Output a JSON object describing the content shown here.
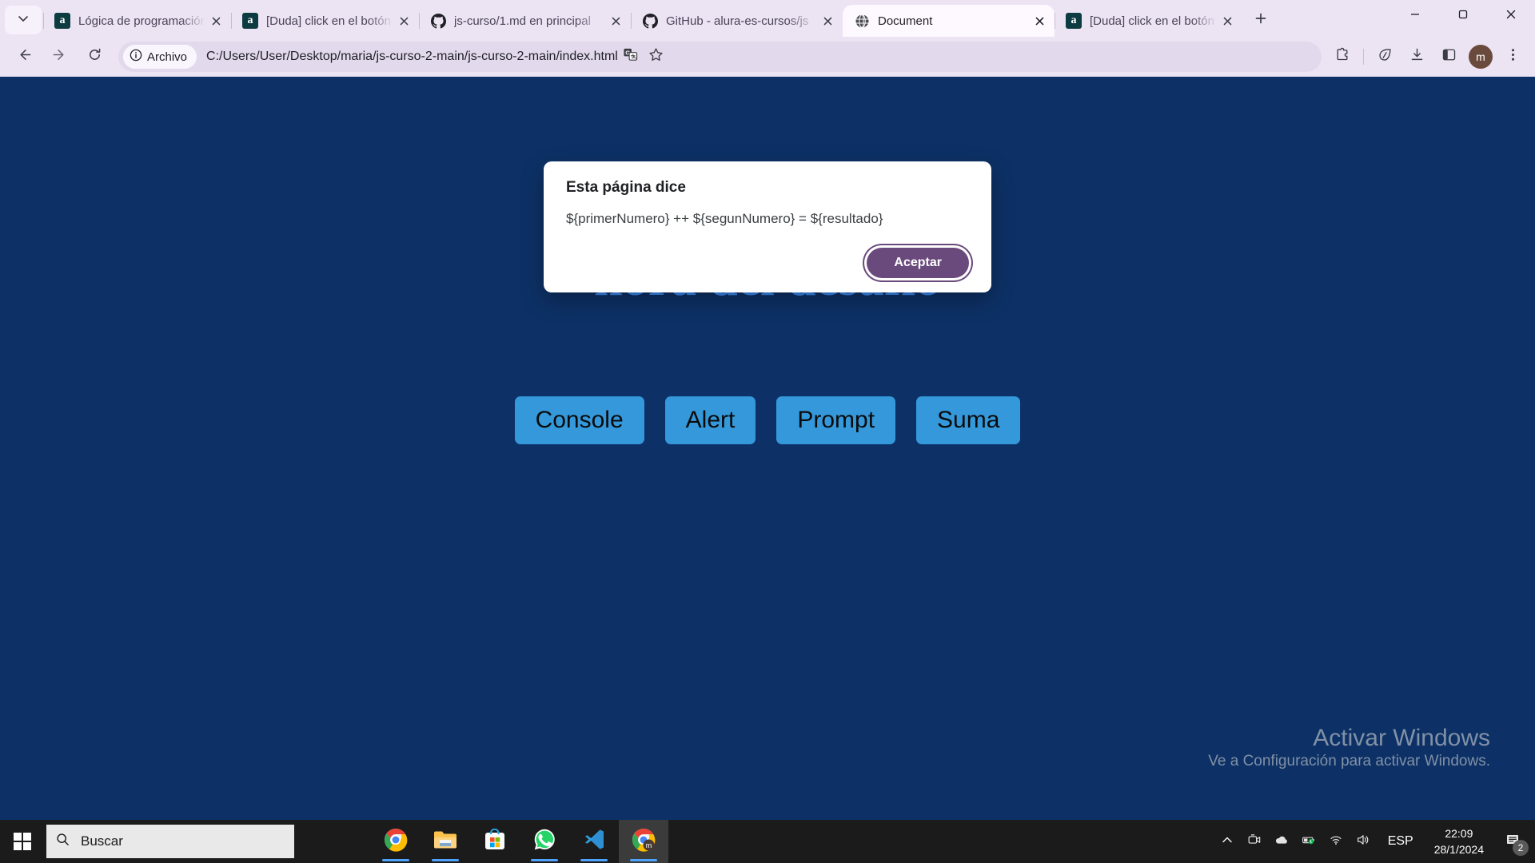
{
  "browser": {
    "tab_list_icon": "chevron-down-icon",
    "tabs": [
      {
        "title": "Lógica de programación: e",
        "favicon": "alura-icon",
        "active": false
      },
      {
        "title": "[Duda] click en el botón | L",
        "favicon": "alura-icon",
        "active": false
      },
      {
        "title": "js-curso/1.md en principal",
        "favicon": "github-icon",
        "active": false
      },
      {
        "title": "GitHub - alura-es-cursos/js",
        "favicon": "github-icon",
        "active": false
      },
      {
        "title": "Document",
        "favicon": "globe-icon",
        "active": true
      },
      {
        "title": "[Duda] click en el botón | L",
        "favicon": "alura-icon",
        "active": false
      }
    ],
    "new_tab_label": "+",
    "window_controls": {
      "minimize": "minimize-icon",
      "maximize": "maximize-icon",
      "close": "close-icon"
    },
    "toolbar": {
      "back": "back-arrow-icon",
      "forward": "forward-arrow-icon",
      "reload": "reload-icon",
      "security_chip_label": "Archivo",
      "security_chip_icon": "info-circle-icon",
      "url": "C:/Users/User/Desktop/maria/js-curso-2-main/js-curso-2-main/index.html",
      "translate_icon": "translate-icon",
      "bookmark_icon": "star-icon",
      "extensions_icon": "puzzle-piece-icon",
      "performance_icon": "leaf-icon",
      "downloads_icon": "download-icon",
      "side_panel_icon": "side-panel-icon",
      "profile_initial": "m",
      "menu_icon": "three-dots-menu-icon"
    }
  },
  "page": {
    "heading": "hora del desafío",
    "buttons": [
      "Console",
      "Alert",
      "Prompt",
      "Suma"
    ],
    "background_color": "#0d3166",
    "button_color": "#3498db",
    "heading_color": "#3d8bf2"
  },
  "dialog": {
    "title": "Esta página dice",
    "message": "${primerNumero} ++ ${segunNumero} = ${resultado}",
    "ok_label": "Aceptar",
    "ok_color": "#6a4a7c"
  },
  "watermark": {
    "title": "Activar Windows",
    "subtitle": "Ve a Configuración para activar Windows."
  },
  "taskbar": {
    "start_icon": "windows-logo-icon",
    "search_placeholder": "Buscar",
    "search_icon": "search-icon",
    "apps": [
      {
        "name": "chrome-icon",
        "active": false,
        "running": true
      },
      {
        "name": "file-explorer-icon",
        "active": false,
        "running": true
      },
      {
        "name": "microsoft-store-icon",
        "active": false,
        "running": false
      },
      {
        "name": "whatsapp-icon",
        "active": false,
        "running": true
      },
      {
        "name": "vscode-icon",
        "active": false,
        "running": true
      },
      {
        "name": "chrome-profile-icon",
        "active": true,
        "running": true
      }
    ],
    "tray": {
      "overflow_icon": "chevron-up-icon",
      "meet_icon": "camera-icon",
      "onedrive_icon": "cloud-icon",
      "battery_icon": "battery-icon",
      "wifi_icon": "wifi-icon",
      "volume_icon": "speaker-icon",
      "language": "ESP",
      "time": "22:09",
      "date": "28/1/2024",
      "notifications_icon": "notifications-icon",
      "notifications_count": "2"
    }
  }
}
